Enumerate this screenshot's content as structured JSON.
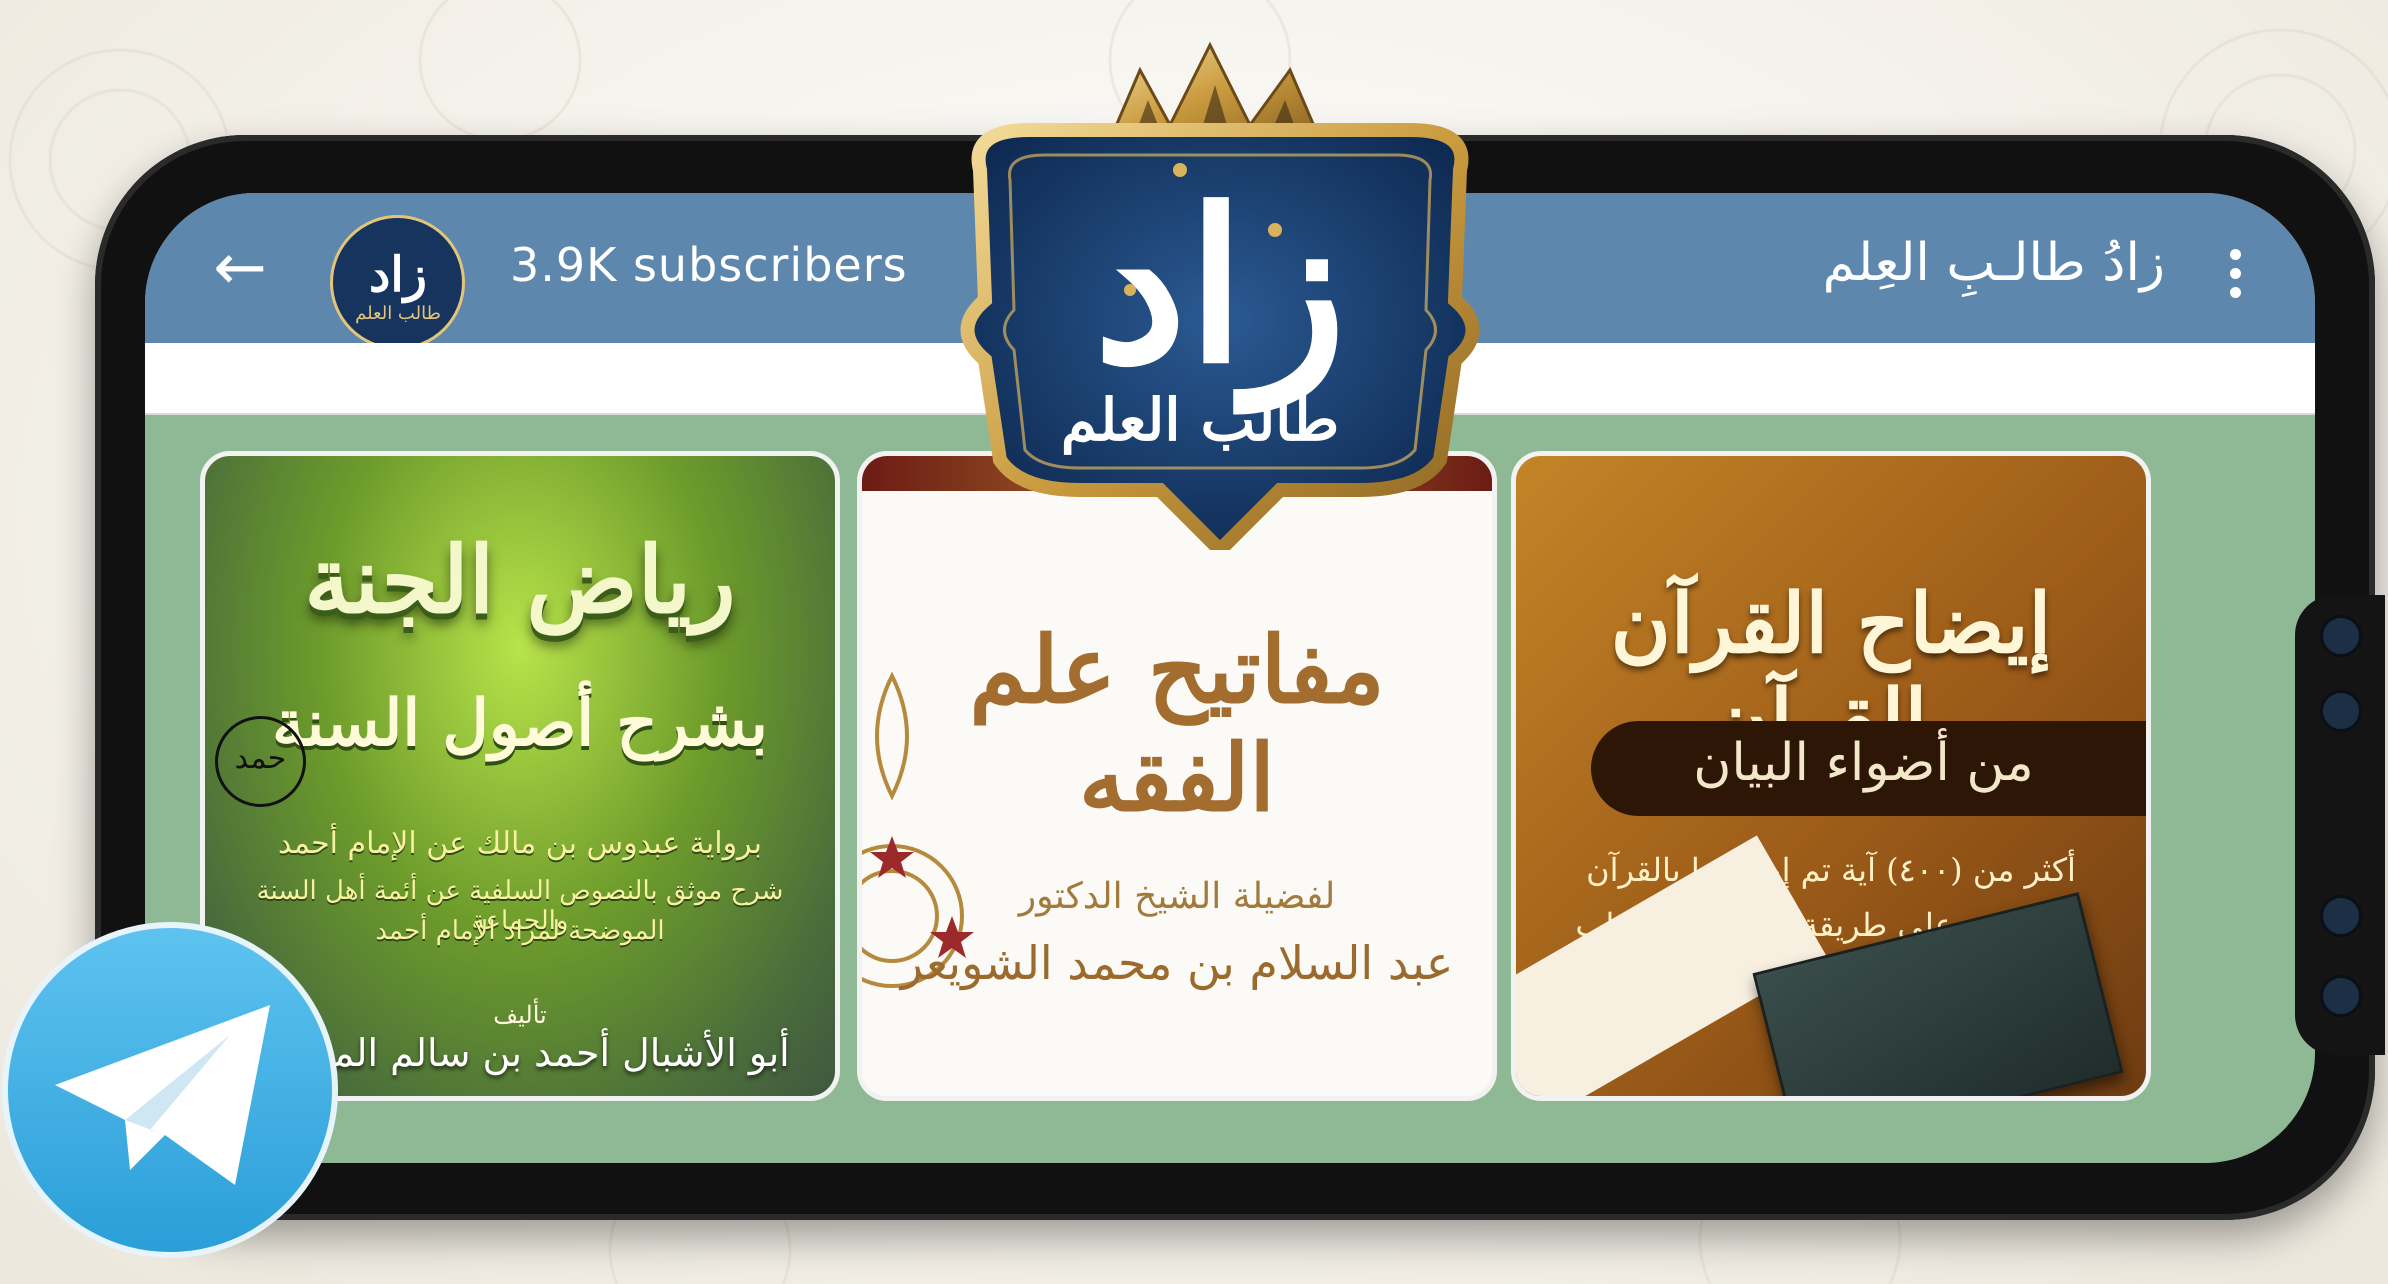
{
  "header": {
    "subscribers": "3.9K subscribers",
    "channel_title": "زادُ طالـبِ العِلم"
  },
  "emblem": {
    "main": "زاد",
    "sub": "طالب العلم"
  },
  "avatar": {
    "main": "زاد",
    "sub": "طالب العلم"
  },
  "posts": [
    {
      "title": "رياض الجنة",
      "subtitle": "بشرح أصول السنة",
      "lines": [
        "برواية عبدوس بن مالك عن الإمام أحمد",
        "شرح موثق بالنصوص السلفية عن أئمة أهل السنة والجماعة",
        "الموضحة لمراد الإمام أحمد"
      ],
      "author_label": "تأليف",
      "author": "أبو الأشبال أحمد بن سالم المصري",
      "seal": "حمد"
    },
    {
      "title": "مفاتيح علم الفقه",
      "lines": [
        "لفضيلة الشيخ الدكتور",
        "عبد السلام بن محمد الشويعر"
      ]
    },
    {
      "title": "إيضاح القرآن بالقرآن",
      "band": "من أضواء البيان",
      "lines": [
        "أكثر من (٤٠٠) آية تم إيضاحها بالقرآن",
        "مجدولة، وعلى طريقة السؤال والجواب"
      ]
    }
  ],
  "colors": {
    "topbar": "#5d87ad",
    "chat_bg": "#8fb894",
    "emblem_bg": "#153a6b",
    "gold": "#d9b25c"
  },
  "icons": [
    "back-arrow-icon",
    "menu-dots-icon",
    "telegram-icon",
    "camera-icon"
  ]
}
